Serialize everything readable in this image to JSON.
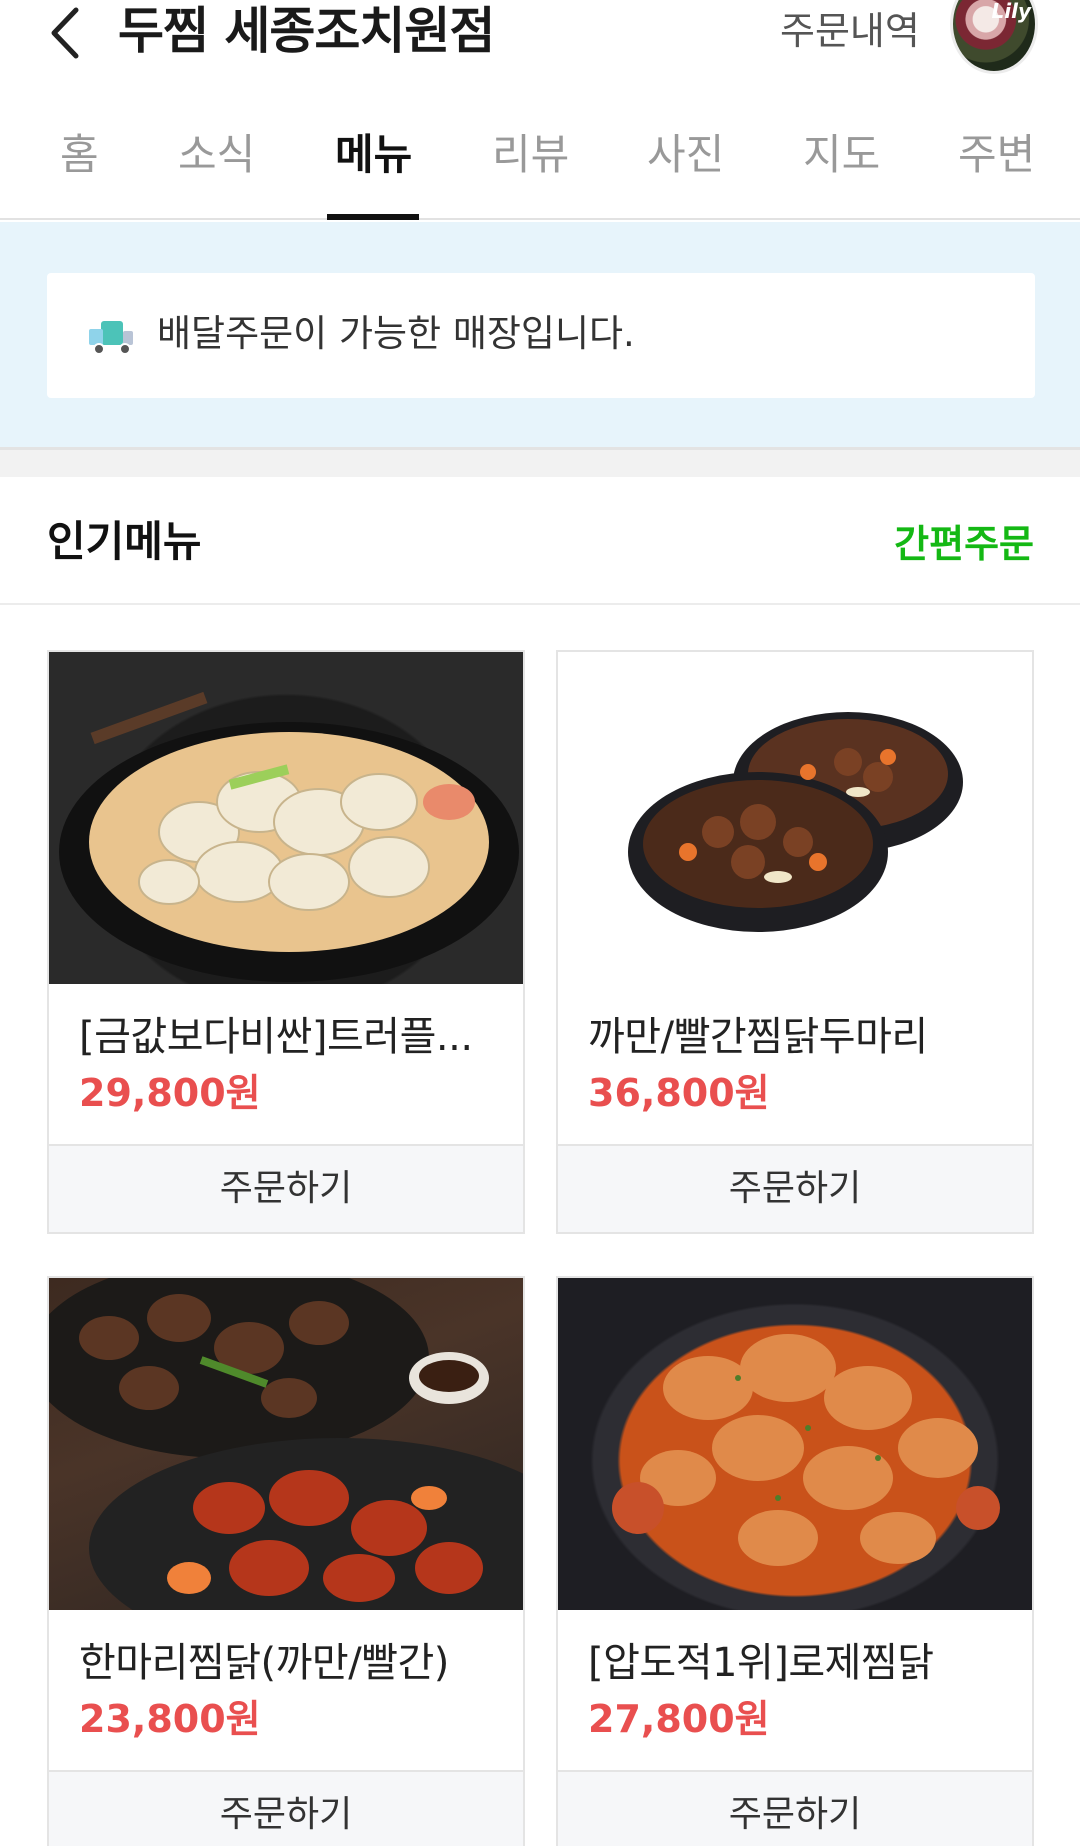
{
  "header": {
    "store_title": "두찜 세종조치원점",
    "order_history_label": "주문내역",
    "avatar_text": "Lily"
  },
  "tabs": [
    {
      "label": "홈"
    },
    {
      "label": "소식"
    },
    {
      "label": "메뉴",
      "active": true
    },
    {
      "label": "리뷰"
    },
    {
      "label": "사진"
    },
    {
      "label": "지도"
    },
    {
      "label": "주변"
    }
  ],
  "banner": {
    "text": "배달주문이 가능한 매장입니다.",
    "icon": "delivery-truck-icon"
  },
  "section": {
    "title": "인기메뉴",
    "quick_order_label": "간편주문"
  },
  "menu_items": [
    {
      "name": "[금값보다비싼]트러플...",
      "price": "29,800원",
      "button": "주문하기"
    },
    {
      "name": "까만/빨간찜닭두마리",
      "price": "36,800원",
      "button": "주문하기"
    },
    {
      "name": "한마리찜닭(까만/빨간)",
      "price": "23,800원",
      "button": "주문하기"
    },
    {
      "name": "[압도적1위]로제찜닭",
      "price": "27,800원",
      "button": "주문하기"
    }
  ],
  "colors": {
    "price": "#e94f4f",
    "quick_order": "#14b814",
    "banner_bg": "#e7f4fb",
    "tab_active": "#111111"
  }
}
